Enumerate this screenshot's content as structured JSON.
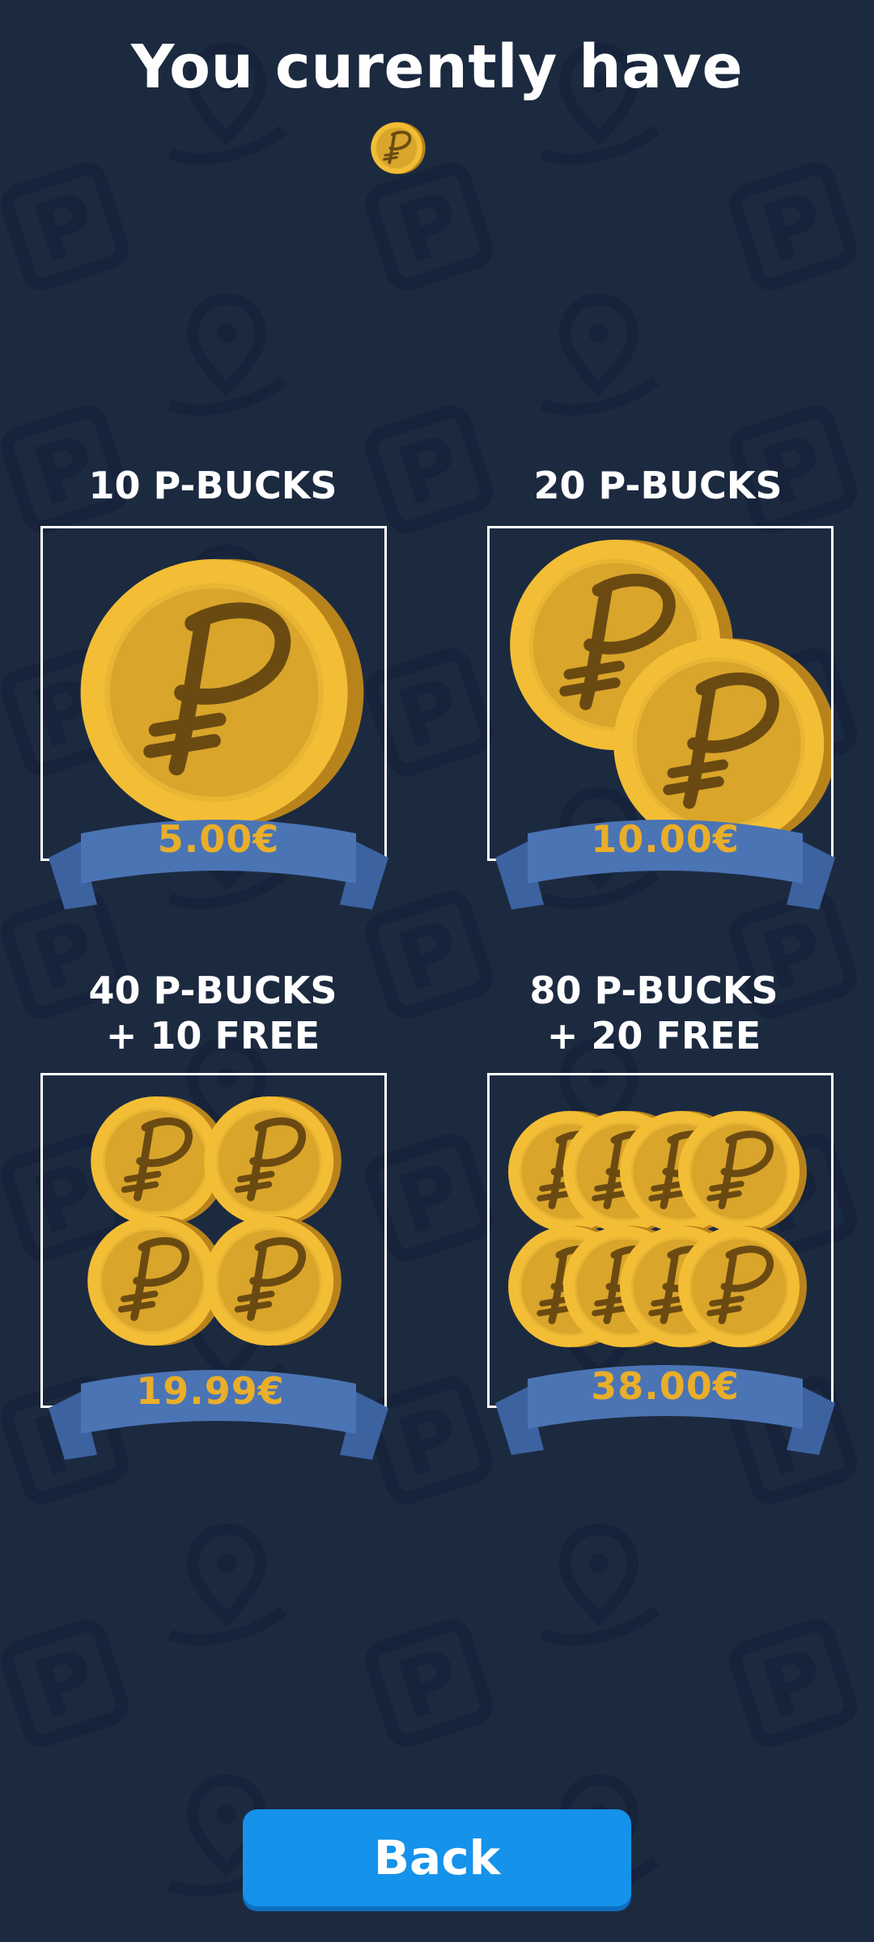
{
  "header": {
    "title": "You curently have",
    "balance_icon": "coin-icon"
  },
  "offers": [
    {
      "title_line1": "10 P-BUCKS",
      "title_line2": "",
      "price": "5.00€",
      "coin_count": 1
    },
    {
      "title_line1": "20 P-BUCKS",
      "title_line2": "",
      "price": "10.00€",
      "coin_count": 2
    },
    {
      "title_line1": "40 P-BUCKS",
      "title_line2": "+ 10 FREE",
      "price": "19.99€",
      "coin_count": 4
    },
    {
      "title_line1": "80 P-BUCKS",
      "title_line2": "+ 20 FREE",
      "price": "38.00€",
      "coin_count": 8
    }
  ],
  "footer": {
    "back_label": "Back"
  },
  "colors": {
    "background": "#1c2a40",
    "coin_gold": "#f0bb33",
    "ribbon_blue": "#4a74b4",
    "price_gold": "#e9ae2a",
    "button_blue": "#1592ea"
  }
}
